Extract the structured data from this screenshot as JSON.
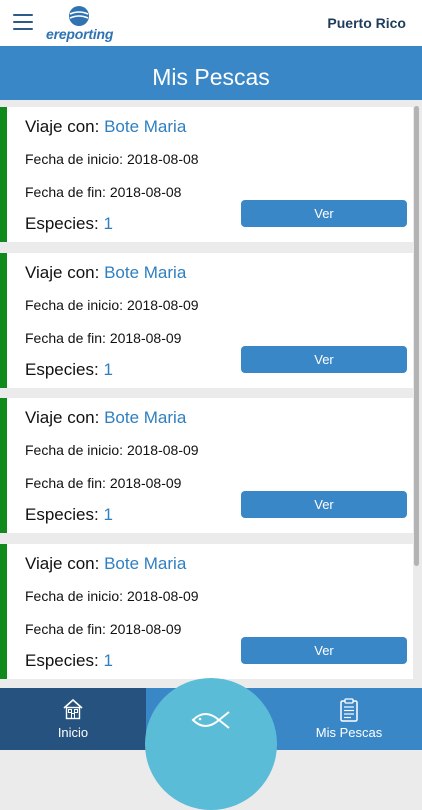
{
  "header": {
    "logo_text": "ereporting",
    "region": "Puerto Rico"
  },
  "page_title": "Mis Pescas",
  "trips": [
    {
      "trip_label": "Viaje con: ",
      "boat": "Bote Maria",
      "start_label": "Fecha de inicio: ",
      "start_date": "2018-08-08",
      "end_label": "Fecha de fin: ",
      "end_date": "2018-08-08",
      "species_label": "Especies: ",
      "species_count": "1",
      "button_label": "Ver"
    },
    {
      "trip_label": "Viaje con: ",
      "boat": "Bote Maria",
      "start_label": "Fecha de inicio: ",
      "start_date": "2018-08-09",
      "end_label": "Fecha de fin: ",
      "end_date": "2018-08-09",
      "species_label": "Especies: ",
      "species_count": "1",
      "button_label": "Ver"
    },
    {
      "trip_label": "Viaje con: ",
      "boat": "Bote Maria",
      "start_label": "Fecha de inicio: ",
      "start_date": "2018-08-09",
      "end_label": "Fecha de fin: ",
      "end_date": "2018-08-09",
      "species_label": "Especies: ",
      "species_count": "1",
      "button_label": "Ver"
    },
    {
      "trip_label": "Viaje con: ",
      "boat": "Bote Maria",
      "start_label": "Fecha de inicio: ",
      "start_date": "2018-08-09",
      "end_label": "Fecha de fin: ",
      "end_date": "2018-08-09",
      "species_label": "Especies: ",
      "species_count": "1",
      "button_label": "Ver"
    }
  ],
  "bottom_nav": {
    "home_label": "Inicio",
    "home_icon": "house-icon",
    "fab_icon": "fish-icon",
    "pescas_label": "Mis Pescas",
    "pescas_icon": "clipboard-icon"
  },
  "colors": {
    "primary": "#3a87c8",
    "dark_nav": "#25527f",
    "fab": "#5bbcd8",
    "card_accent": "#118a1d",
    "link_text": "#2f7fc0"
  }
}
